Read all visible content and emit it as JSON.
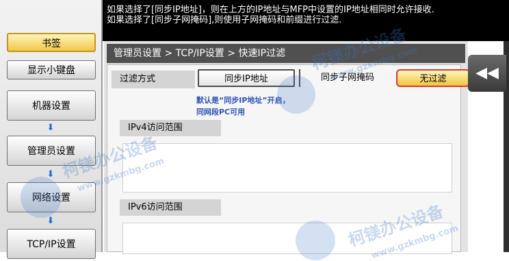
{
  "message": {
    "line1": "如果选择了[同步IP地址]，则在上方的IP地址与MFP中设置的IP地址相同时允许接收.",
    "line2": "如果选择了[同步子网掩码],则使用子网掩码和前缀进行过滤."
  },
  "sidebar": {
    "bookmark": "书签",
    "show_keypad": "显示小键盘",
    "machine_settings": "机器设置",
    "admin_settings": "管理员设置",
    "network_settings": "网络设置",
    "tcpip_settings": "TCP/IP设置",
    "arrow": "⬇"
  },
  "panel": {
    "breadcrumb": "管理员设置 > TCP/IP设置 > 快速IP过滤",
    "filter_method_label": "过滤方式",
    "options": {
      "sync_ip": "同步IP地址",
      "sync_subnet": "同步子网掩码",
      "no_filter": "无过滤"
    },
    "note_line1": "默认是“同步IP地址”开启，",
    "note_line2": "同网段PC可用",
    "ipv4_label": "IPv4访问范围",
    "ipv6_label": "IPv6访问范围"
  },
  "back_button": "◀◀",
  "watermark": {
    "text": "柯镁办公设备",
    "url": "www.gzkmbg.com"
  },
  "colors": {
    "selected_fill": "#f0c640",
    "highlight_border": "#d33a2c",
    "note_text": "#2f53b6",
    "arrow": "#1769d8"
  }
}
